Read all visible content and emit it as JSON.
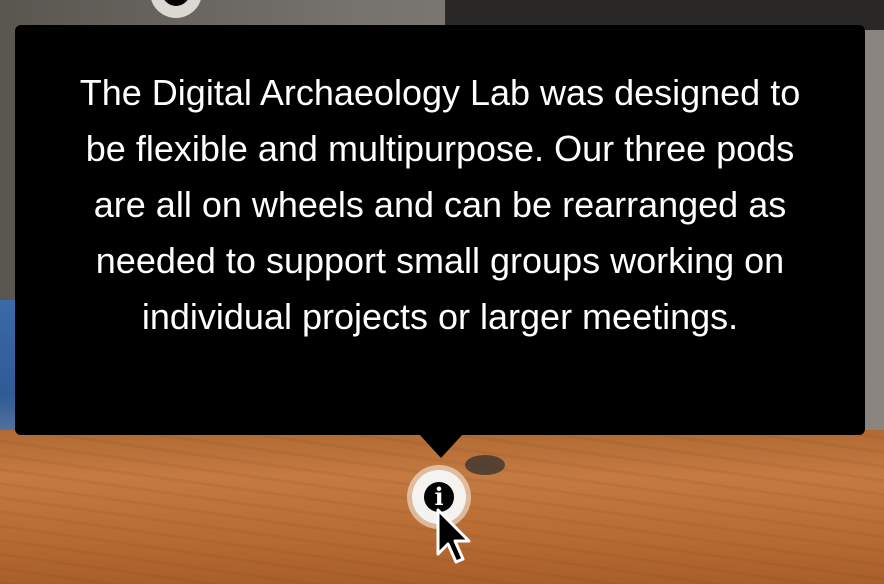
{
  "tooltip": {
    "text": "The Digital Archaeology Lab was designed to be flexible and multipurpose. Our three pods are all on wheels and can be rearranged as needed to support small groups working on individual projects or larger meetings."
  },
  "hotspot": {
    "icon": "info-icon",
    "glyph": "i"
  },
  "background_hotspot": {
    "icon": "info-icon"
  },
  "colors": {
    "tooltip_background": "#000000",
    "tooltip_text": "#ffffff",
    "hotspot_ring": "#f5f3ef",
    "table_wood": "#c47a40"
  }
}
